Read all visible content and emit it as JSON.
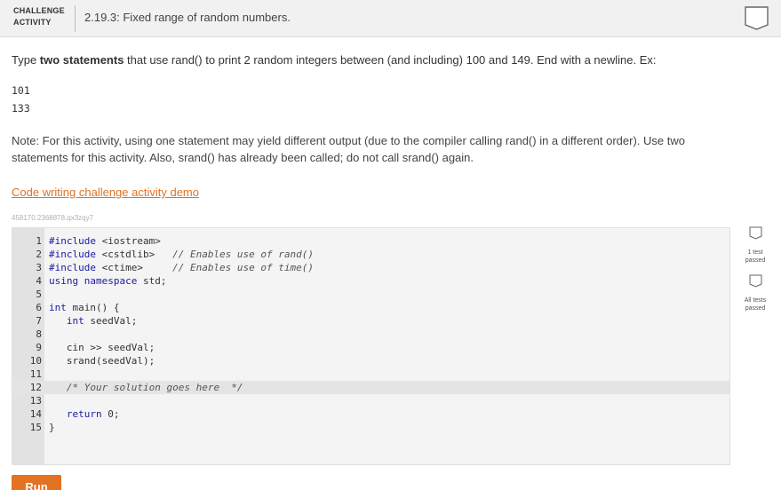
{
  "header": {
    "badge_line1": "CHALLENGE",
    "badge_line2": "ACTIVITY",
    "title": "2.19.3: Fixed range of random numbers."
  },
  "instructions": {
    "part1": "Type ",
    "bold": "two statements",
    "part2": " that use rand() to print 2 random integers between (and including) 100 and 149. End with a newline. Ex:"
  },
  "example_output": [
    "101",
    "133"
  ],
  "note": "Note: For this activity, using one statement may yield different output (due to the compiler calling rand() in a different order). Use two statements for this activity. Also, srand() has already been called; do not call srand() again.",
  "demo_link": "Code writing challenge activity demo",
  "activity_id": "458170.2368878.qx3zqy7",
  "code": {
    "lines": [
      {
        "n": "1",
        "text": "#include <iostream>"
      },
      {
        "n": "2",
        "text": "#include <cstdlib>   // Enables use of rand()"
      },
      {
        "n": "3",
        "text": "#include <ctime>     // Enables use of time()"
      },
      {
        "n": "4",
        "text": "using namespace std;"
      },
      {
        "n": "5",
        "text": ""
      },
      {
        "n": "6",
        "text": "int main() {"
      },
      {
        "n": "7",
        "text": "   int seedVal;"
      },
      {
        "n": "8",
        "text": ""
      },
      {
        "n": "9",
        "text": "   cin >> seedVal;"
      },
      {
        "n": "10",
        "text": "   srand(seedVal);"
      },
      {
        "n": "11",
        "text": ""
      },
      {
        "n": "12",
        "text": "   /* Your solution goes here  */"
      },
      {
        "n": "13",
        "text": ""
      },
      {
        "n": "14",
        "text": "   return 0;"
      },
      {
        "n": "15",
        "text": "}"
      }
    ]
  },
  "tests": {
    "test1_label": "1 test passed",
    "all_label": "All tests passed"
  },
  "run_label": "Run",
  "colors": {
    "accent": "#e37222",
    "header_bg": "#f1f1f1",
    "editor_bg": "#f4f4f4",
    "gutter_bg": "#e2e2e2"
  }
}
